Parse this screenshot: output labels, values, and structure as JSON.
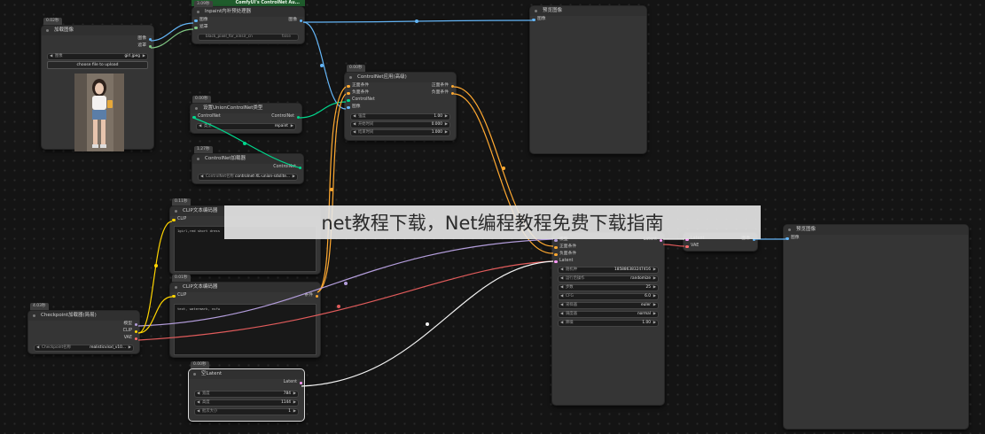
{
  "banner": "net教程下载，Net编程教程免费下载指南",
  "nodes": {
    "load_image": {
      "badge": "0.02秒",
      "title": "加载图像",
      "out1": "图像",
      "out2": "遮罩",
      "image_label": "图像",
      "image_value": "girl.jpeg",
      "upload_label": "choose file to upload"
    },
    "inpaint_pre": {
      "badge": "3.09秒",
      "header": "ComfyUI's ControlNet Au...",
      "title": "Inpaint内补预处理器",
      "in1": "图像",
      "in2": "遮罩",
      "out1": "图像",
      "widget_value": "black_pixel_for_xinsir_cn",
      "widget_right": "false"
    },
    "preview_top": {
      "title": "预览图像",
      "in1": "图像"
    },
    "controlnet_apply": {
      "badge": "0.00秒",
      "title": "ControlNet应用(高级)",
      "in1": "正面条件",
      "in2": "负面条件",
      "in3": "ControlNet",
      "in4": "图像",
      "out1": "正面条件",
      "out2": "负面条件",
      "w1_label": "强度",
      "w1_value": "1.00",
      "w2_label": "开始时间",
      "w2_value": "0.000",
      "w3_label": "结束时间",
      "w3_value": "1.000"
    },
    "union_type": {
      "badge": "0.00秒",
      "title": "设置UnionControlNet类型",
      "in1": "ControlNet",
      "out1": "ControlNet",
      "w_label": "类型",
      "w_value": "repaint"
    },
    "controlnet_loader": {
      "badge": "1.27秒",
      "title": "ControlNet加载器",
      "out1": "ControlNet",
      "w_label": "ControlNet名称",
      "w_value": "controlnet-XL-union-sdxlite..."
    },
    "clip_pos": {
      "badge": "0.11秒",
      "title": "CLIP文本编码器",
      "in1": "CLIP",
      "text": "1girl,red short dress"
    },
    "clip_neg": {
      "badge": "0.01秒",
      "title": "CLIP文本编码器",
      "in1": "CLIP",
      "out1": "条件",
      "text": "text, watermark, nsfw"
    },
    "checkpoint": {
      "badge": "4.03秒",
      "title": "Checkpoint加载器(简易)",
      "out1": "模型",
      "out2": "CLIP",
      "out3": "VAE",
      "w_label": "Checkpoint名称",
      "w_value": "realisticvisxl_v10..."
    },
    "empty_latent": {
      "badge": "0.00秒",
      "title": "空Latent",
      "out1": "Latent",
      "w1_label": "宽度",
      "w1_value": "784",
      "w2_label": "高度",
      "w2_value": "1144",
      "w3_label": "批次大小",
      "w3_value": "1"
    },
    "ksampler": {
      "in1": "模型",
      "in2": "正面条件",
      "in3": "负面条件",
      "in4": "Latent",
      "out1": "Latent",
      "rows": [
        {
          "label": "随机种",
          "value": "185886383247416"
        },
        {
          "label": "运行后操作",
          "value": "randomize"
        },
        {
          "label": "步数",
          "value": "25"
        },
        {
          "label": "CFG",
          "value": "6.0"
        },
        {
          "label": "采样器",
          "value": "euler"
        },
        {
          "label": "调度器",
          "value": "normal"
        },
        {
          "label": "降噪",
          "value": "1.00"
        }
      ]
    },
    "vae_decode": {
      "in1": "Latent",
      "in2": "VAE",
      "out1": "图像"
    },
    "preview_right": {
      "title": "预览图像",
      "in1": "图像"
    }
  },
  "colors": {
    "image": "#64b5f6",
    "mask": "#81c784",
    "conditioning": "#ffa931",
    "controlnet": "#00d78d",
    "clip": "#ffd500",
    "model": "#b39ddb",
    "vae": "#ff6e6e",
    "latent": "#ff9cf9"
  }
}
